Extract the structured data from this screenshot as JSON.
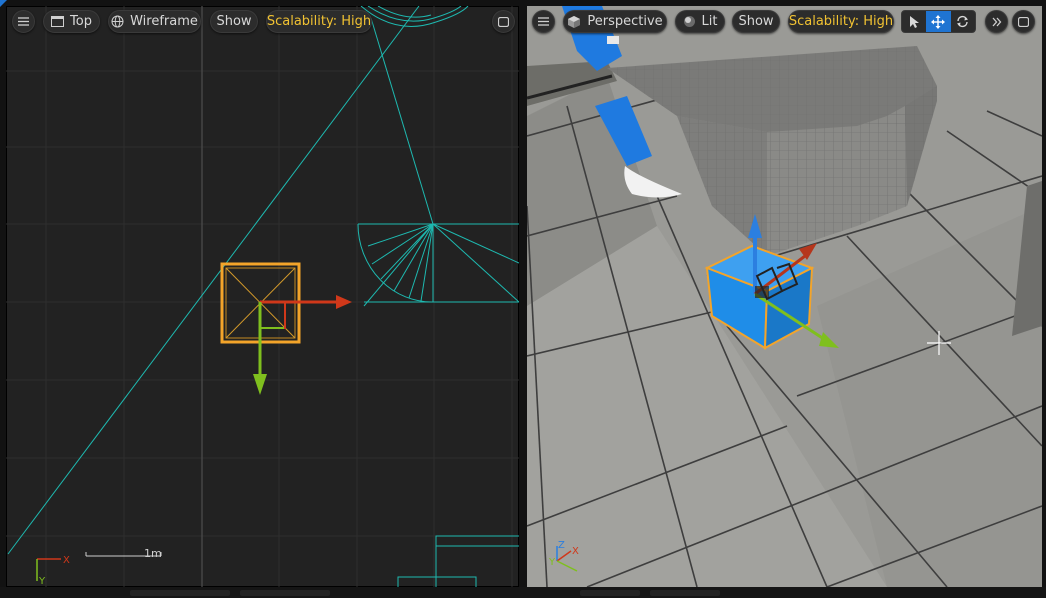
{
  "left_viewport": {
    "view_mode": "Top",
    "render_mode": "Wireframe",
    "show_label": "Show",
    "scalability": "Scalability: High",
    "scale_label": "1m",
    "axis_x": "X",
    "axis_y": "Y"
  },
  "right_viewport": {
    "view_mode": "Perspective",
    "lit_label": "Lit",
    "show_label": "Show",
    "scalability": "Scalability: High",
    "axis_x": "X",
    "axis_y": "Y",
    "axis_z": "Z",
    "active_tool": "move"
  },
  "icons": {
    "menu": "hamburger-menu-icon",
    "top_view": "window-icon",
    "wireframe": "globe-wireframe-icon",
    "perspective": "cube-icon",
    "lit": "lit-sphere-icon",
    "maximize": "maximize-icon",
    "select": "select-arrow-icon",
    "move": "move-arrows-icon",
    "rotate": "rotate-icon",
    "overflow": "double-chevron-right-icon"
  },
  "colors": {
    "selection_outline": "#f3a42a",
    "axis_x": "#d0381a",
    "axis_y": "#7fbf1e",
    "axis_z": "#2b7fe0",
    "wireframe": "#1eb9b0",
    "scalability_text": "#f1c232",
    "active_tool": "#1f74d2",
    "cube": "#1f8de8"
  }
}
